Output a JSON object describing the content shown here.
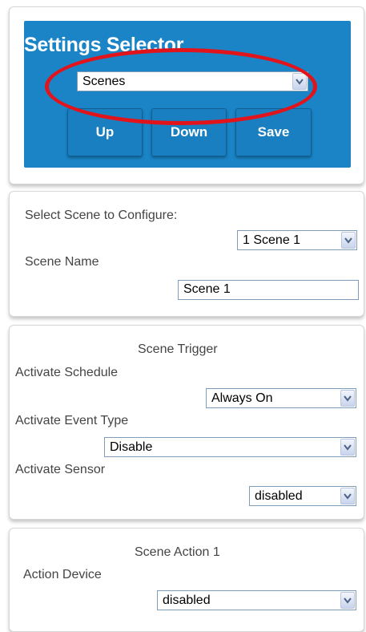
{
  "settings_selector": {
    "title": "Settings Selector",
    "mode_select_value": "Scenes",
    "buttons": {
      "up": "Up",
      "down": "Down",
      "save": "Save"
    },
    "annotation_color": "#e2141b",
    "accent_color": "#1a84c6"
  },
  "scene_config": {
    "select_label": "Select Scene to Configure:",
    "scene_select_value": "1 Scene 1",
    "name_label": "Scene Name",
    "name_value": "Scene 1"
  },
  "scene_trigger": {
    "heading": "Scene Trigger",
    "schedule_label": "Activate Schedule",
    "schedule_value": "Always On",
    "event_type_label": "Activate Event Type",
    "event_type_value": "Disable",
    "sensor_label": "Activate Sensor",
    "sensor_value": "disabled"
  },
  "scene_action": {
    "heading": "Scene Action 1",
    "device_label": "Action Device",
    "device_value": "disabled"
  },
  "icons": {
    "dropdown": "chevron-down-icon"
  }
}
